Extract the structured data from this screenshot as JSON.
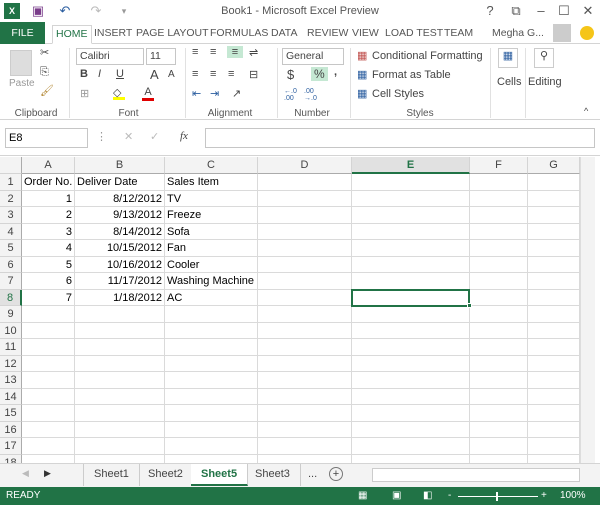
{
  "window": {
    "title": "Book1 - Microsoft Excel Preview",
    "help": "?",
    "user": "Megha G..."
  },
  "tabs": [
    "FILE",
    "HOME",
    "INSERT",
    "PAGE LAYOUT",
    "FORMULAS",
    "DATA",
    "REVIEW",
    "VIEW",
    "LOAD TEST",
    "TEAM"
  ],
  "ribbon": {
    "clipboard": {
      "label": "Clipboard",
      "paste": "Paste"
    },
    "font": {
      "label": "Font",
      "name": "Calibri",
      "size": "11",
      "bold": "B",
      "italic": "I",
      "underline": "U",
      "grow": "A",
      "shrink": "A",
      "color": "A"
    },
    "alignment": {
      "label": "Alignment"
    },
    "number": {
      "label": "Number",
      "format": "General",
      "currency": "$",
      "percent": "%",
      "comma": ",",
      "inc": "←.0 .00",
      "dec": ".00 →.0"
    },
    "styles": {
      "label": "Styles",
      "conditional": "Conditional Formatting",
      "table": "Format as Table",
      "cell_styles": "Cell Styles"
    },
    "cells": {
      "label": "Cells"
    },
    "editing": {
      "label": "Editing"
    }
  },
  "formula_bar": {
    "name_box": "E8",
    "fx": "fx",
    "value": ""
  },
  "columns": [
    "A",
    "B",
    "C",
    "D",
    "E",
    "F",
    "G"
  ],
  "selected": {
    "column": "E",
    "row": 8
  },
  "rows": [
    [
      "Order No.",
      "Deliver Date",
      "Sales Item"
    ],
    [
      "1",
      "8/12/2012",
      "TV"
    ],
    [
      "2",
      "9/13/2012",
      "Freeze"
    ],
    [
      "3",
      "8/14/2012",
      "Sofa"
    ],
    [
      "4",
      "10/15/2012",
      "Fan"
    ],
    [
      "5",
      "10/16/2012",
      "Cooler"
    ],
    [
      "6",
      "11/17/2012",
      "Washing Machine"
    ],
    [
      "7",
      "1/18/2012",
      "AC"
    ]
  ],
  "row_count": 18,
  "sheets": [
    "Sheet1",
    "Sheet2",
    "Sheet5",
    "Sheet3"
  ],
  "active_sheet": "Sheet5",
  "more_sheets": "...",
  "status": {
    "mode": "READY",
    "zoom": "100%"
  },
  "colors": {
    "accent": "#217346"
  }
}
